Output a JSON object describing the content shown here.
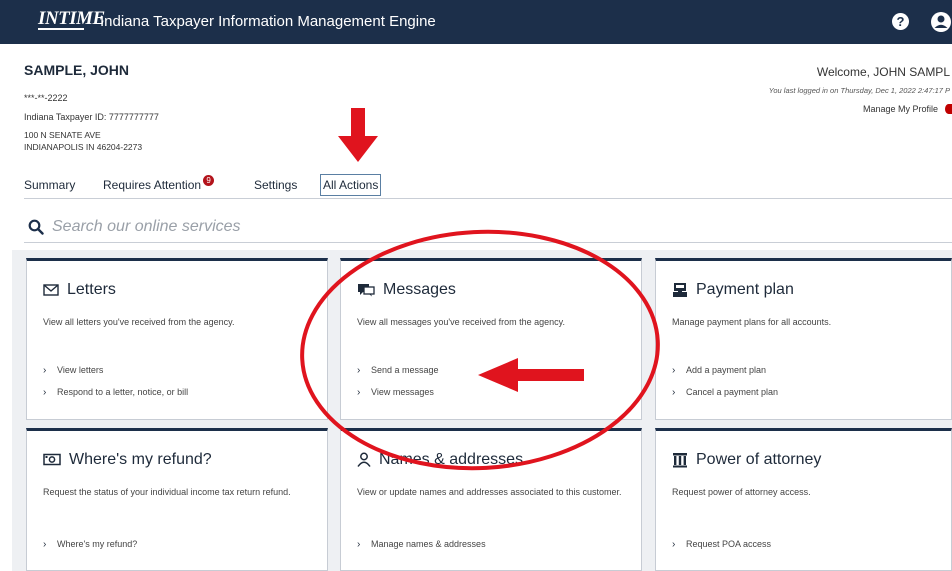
{
  "header": {
    "logo": "INTIME",
    "title": "Indiana Taxpayer Information Management Engine",
    "help_glyph": "?"
  },
  "user": {
    "name": "SAMPLE, JOHN",
    "ssn": "***-**-2222",
    "taxpayer_id": "Indiana Taxpayer ID: 7777777777",
    "address_line1": "100 N SENATE AVE",
    "address_line2": "INDIANAPOLIS IN 46204-2273",
    "welcome": "Welcome, JOHN SAMPL",
    "last_login": "You last logged in on Thursday, Dec 1, 2022 2:47:17 P",
    "manage_profile": "Manage My Profile"
  },
  "tabs": {
    "summary": "Summary",
    "requires_attention": "Requires Attention",
    "requires_attention_count": "9",
    "settings": "Settings",
    "all_actions": "All Actions"
  },
  "search": {
    "placeholder": "Search our online services"
  },
  "cards": {
    "letters": {
      "title": "Letters",
      "icon": "envelope-icon",
      "description": "View all letters you've received from the agency.",
      "links": [
        "View letters",
        "Respond to a letter, notice, or bill"
      ]
    },
    "messages": {
      "title": "Messages",
      "icon": "chat-icon",
      "description": "View all messages you've received from the agency.",
      "links": [
        "Send a message",
        "View messages"
      ]
    },
    "payment_plan": {
      "title": "Payment plan",
      "icon": "register-icon",
      "description": "Manage payment plans for all accounts.",
      "links": [
        "Add a payment plan",
        "Cancel a payment plan"
      ]
    },
    "refund": {
      "title": "Where's my refund?",
      "icon": "money-icon",
      "description": "Request the status of your individual income tax return refund.",
      "links": [
        "Where's my refund?"
      ]
    },
    "names": {
      "title": "Names & addresses",
      "icon": "person-icon",
      "description": "View or update names and addresses associated to this customer.",
      "links": [
        "Manage names & addresses"
      ]
    },
    "poa": {
      "title": "Power of attorney",
      "icon": "building-icon",
      "description": "Request power of attorney access.",
      "links": [
        "Request POA access"
      ]
    }
  },
  "colors": {
    "navy": "#1c2f4a",
    "annotation_red": "#e0141e",
    "badge_red": "#b3131b"
  }
}
